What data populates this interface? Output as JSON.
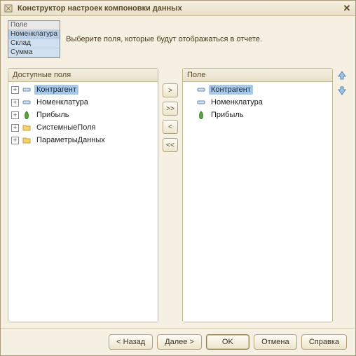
{
  "window": {
    "title": "Конструктор настроек компоновки данных"
  },
  "header": {
    "preview": {
      "head": "Поле",
      "rows": [
        "Номенклатура",
        "Склад",
        "Сумма"
      ]
    },
    "instruction": "Выберите поля, которые будут отображаться в отчете."
  },
  "panels": {
    "available": {
      "title": "Доступные поля",
      "items": [
        {
          "label": "Контрагент",
          "icon": "dash-icon",
          "expandable": true,
          "selected": true
        },
        {
          "label": "Номенклатура",
          "icon": "dash-icon",
          "expandable": true,
          "selected": false
        },
        {
          "label": "Прибыль",
          "icon": "green-icon",
          "expandable": true,
          "selected": false
        },
        {
          "label": "СистемныеПоля",
          "icon": "folder-icon",
          "expandable": true,
          "selected": false
        },
        {
          "label": "ПараметрыДанных",
          "icon": "folder-icon",
          "expandable": true,
          "selected": false
        }
      ]
    },
    "selected": {
      "title": "Поле",
      "items": [
        {
          "label": "Контрагент",
          "icon": "dash-icon",
          "expandable": false,
          "selected": true
        },
        {
          "label": "Номенклатура",
          "icon": "dash-icon",
          "expandable": false,
          "selected": false
        },
        {
          "label": "Прибыль",
          "icon": "green-icon",
          "expandable": false,
          "selected": false
        }
      ]
    }
  },
  "transfer": {
    "add": ">",
    "add_all": ">>",
    "remove": "<",
    "remove_all": "<<"
  },
  "footer": {
    "back": "< Назад",
    "next": "Далее >",
    "ok": "OK",
    "cancel": "Отмена",
    "help": "Справка"
  }
}
